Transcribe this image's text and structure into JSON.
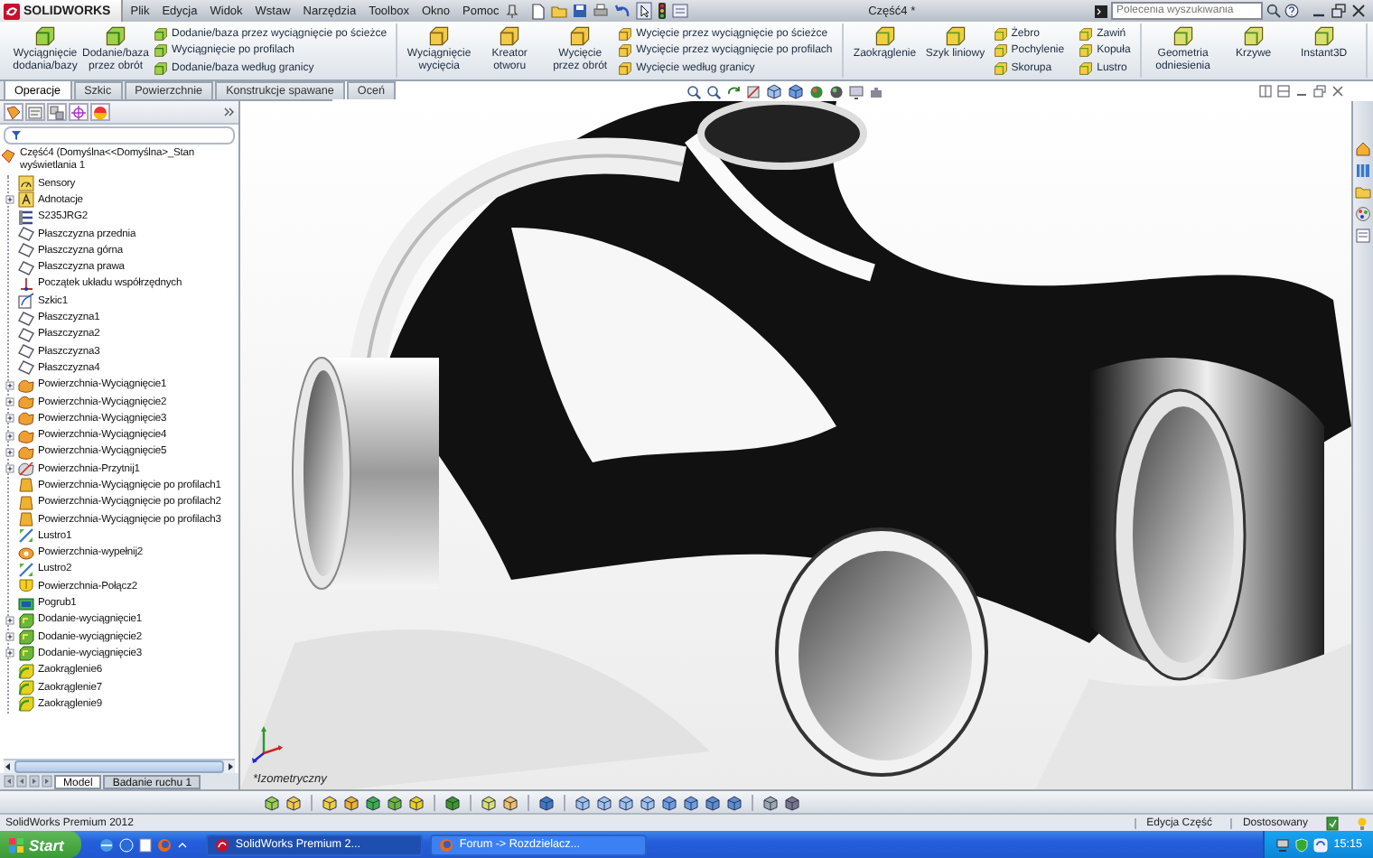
{
  "app": {
    "logo": "SOLIDWORKS",
    "menu": [
      "Plik",
      "Edycja",
      "Widok",
      "Wstaw",
      "Narzędzia",
      "Toolbox",
      "Okno",
      "Pomoc"
    ],
    "title": "Część4 *",
    "search": {
      "placeholder": "Polecenia wyszukiwania"
    }
  },
  "ribbon": {
    "groups": [
      {
        "large": [
          "Wyciągnięcie dodania/bazy",
          "Dodanie/baza przez obrót"
        ],
        "small": [
          "Dodanie/baza przez wyciągnięcie po ścieżce",
          "Wyciągnięcie po profilach",
          "Dodanie/baza według granicy"
        ]
      },
      {
        "large": [
          "Wyciągnięcie wycięcia",
          "Kreator otworu",
          "Wycięcie przez obrót"
        ],
        "small": [
          "Wycięcie przez wyciągnięcie po ścieżce",
          "Wycięcie przez wyciągnięcie po profilach",
          "Wycięcie według granicy"
        ]
      },
      {
        "large": [
          "Zaokrąglenie",
          "Szyk liniowy"
        ],
        "small": [
          "Żebro",
          "Pochylenie",
          "Skorupa",
          "Zawiń",
          "Kopuła",
          "Lustro"
        ]
      },
      {
        "large": [
          "Geometria odniesienia",
          "Krzywe",
          "Instant3D"
        ]
      }
    ]
  },
  "command_tabs": [
    {
      "label": "Operacje",
      "selected": true
    },
    {
      "label": "Szkic",
      "selected": false
    },
    {
      "label": "Powierzchnie",
      "selected": false
    },
    {
      "label": "Konstrukcje spawane",
      "selected": false
    },
    {
      "label": "Oceń",
      "selected": false
    }
  ],
  "feature_tree": {
    "root": "Część4  (Domyślna<<Domyślna>_Stan wyświetlania 1",
    "items": [
      {
        "label": "Sensory",
        "kind": "sensor"
      },
      {
        "label": "Adnotacje",
        "kind": "annotation",
        "expanded": false
      },
      {
        "label": "S235JRG2",
        "kind": "material"
      },
      {
        "label": "Płaszczyzna przednia",
        "kind": "plane"
      },
      {
        "label": "Płaszczyzna górna",
        "kind": "plane"
      },
      {
        "label": "Płaszczyzna prawa",
        "kind": "plane"
      },
      {
        "label": "Początek układu współrzędnych",
        "kind": "origin"
      },
      {
        "label": "Szkic1",
        "kind": "sketch"
      },
      {
        "label": "Płaszczyzna1",
        "kind": "plane"
      },
      {
        "label": "Płaszczyzna2",
        "kind": "plane"
      },
      {
        "label": "Płaszczyzna3",
        "kind": "plane"
      },
      {
        "label": "Płaszczyzna4",
        "kind": "plane"
      },
      {
        "label": "Powierzchnia-Wyciągnięcie1",
        "kind": "surface",
        "expanded": false
      },
      {
        "label": "Powierzchnia-Wyciągnięcie2",
        "kind": "surface",
        "expanded": false
      },
      {
        "label": "Powierzchnia-Wyciągnięcie3",
        "kind": "surface",
        "expanded": false
      },
      {
        "label": "Powierzchnia-Wyciągnięcie4",
        "kind": "surface",
        "expanded": false
      },
      {
        "label": "Powierzchnia-Wyciągnięcie5",
        "kind": "surface",
        "expanded": false
      },
      {
        "label": "Powierzchnia-Przytnij1",
        "kind": "trim",
        "expanded": false
      },
      {
        "label": "Powierzchnia-Wyciągnięcie po profilach1",
        "kind": "loft"
      },
      {
        "label": "Powierzchnia-Wyciągnięcie po profilach2",
        "kind": "loft"
      },
      {
        "label": "Powierzchnia-Wyciągnięcie po profilach3",
        "kind": "loft"
      },
      {
        "label": "Lustro1",
        "kind": "mirror"
      },
      {
        "label": "Powierzchnia-wypełnij2",
        "kind": "fill"
      },
      {
        "label": "Lustro2",
        "kind": "mirror"
      },
      {
        "label": "Powierzchnia-Połącz2",
        "kind": "knit"
      },
      {
        "label": "Pogrub1",
        "kind": "thicken"
      },
      {
        "label": "Dodanie-wyciągnięcie1",
        "kind": "boss",
        "expanded": false
      },
      {
        "label": "Dodanie-wyciągnięcie2",
        "kind": "boss",
        "expanded": false
      },
      {
        "label": "Dodanie-wyciągnięcie3",
        "kind": "boss",
        "expanded": false
      },
      {
        "label": "Zaokrąglenie6",
        "kind": "fillet"
      },
      {
        "label": "Zaokrąglenie7",
        "kind": "fillet"
      },
      {
        "label": "Zaokrąglenie9",
        "kind": "fillet"
      }
    ]
  },
  "bottom_tabs": [
    {
      "label": "Model",
      "selected": true
    },
    {
      "label": "Badanie ruchu 1",
      "selected": false
    }
  ],
  "viewport": {
    "view_label": "*Izometryczny"
  },
  "status_bar": {
    "product": "SolidWorks Premium 2012",
    "mode": "Edycja Część",
    "units": "Dostosowany"
  },
  "taskbar": {
    "start": "Start",
    "windows": [
      {
        "label": "SolidWorks Premium 2...",
        "selected": true
      },
      {
        "label": "Forum -> Rozdzielacz...",
        "selected": false
      }
    ],
    "clock": "15:15"
  }
}
